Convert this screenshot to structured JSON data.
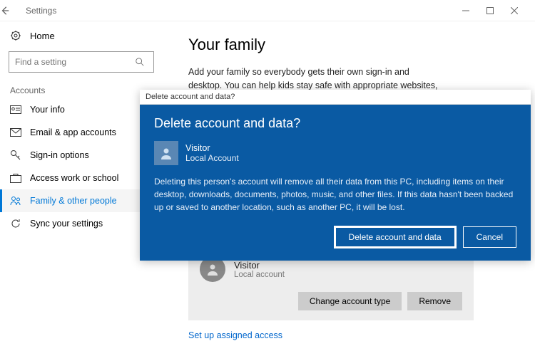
{
  "window": {
    "title": "Settings"
  },
  "sidebar": {
    "home": "Home",
    "search_placeholder": "Find a setting",
    "section": "Accounts",
    "items": [
      {
        "label": "Your info"
      },
      {
        "label": "Email & app accounts"
      },
      {
        "label": "Sign-in options"
      },
      {
        "label": "Access work or school"
      },
      {
        "label": "Family & other people"
      },
      {
        "label": "Sync your settings"
      }
    ]
  },
  "content": {
    "heading": "Your family",
    "description": "Add your family so everybody gets their own sign-in and desktop. You can help kids stay safe with appropriate websites, time limits, apps, and games."
  },
  "user_card": {
    "name": "Visitor",
    "type": "Local account",
    "change_btn": "Change account type",
    "remove_btn": "Remove"
  },
  "assigned_link": "Set up assigned access",
  "dialog": {
    "inner_title": "Delete account and data?",
    "heading": "Delete account and data?",
    "user_name": "Visitor",
    "user_type": "Local Account",
    "message": "Deleting this person's account will remove all their data from this PC, including items on their desktop, downloads, documents, photos, music, and other files. If this data hasn't been backed up or saved to another location, such as another PC, it will be lost.",
    "primary_btn": "Delete account and data",
    "cancel_btn": "Cancel"
  }
}
